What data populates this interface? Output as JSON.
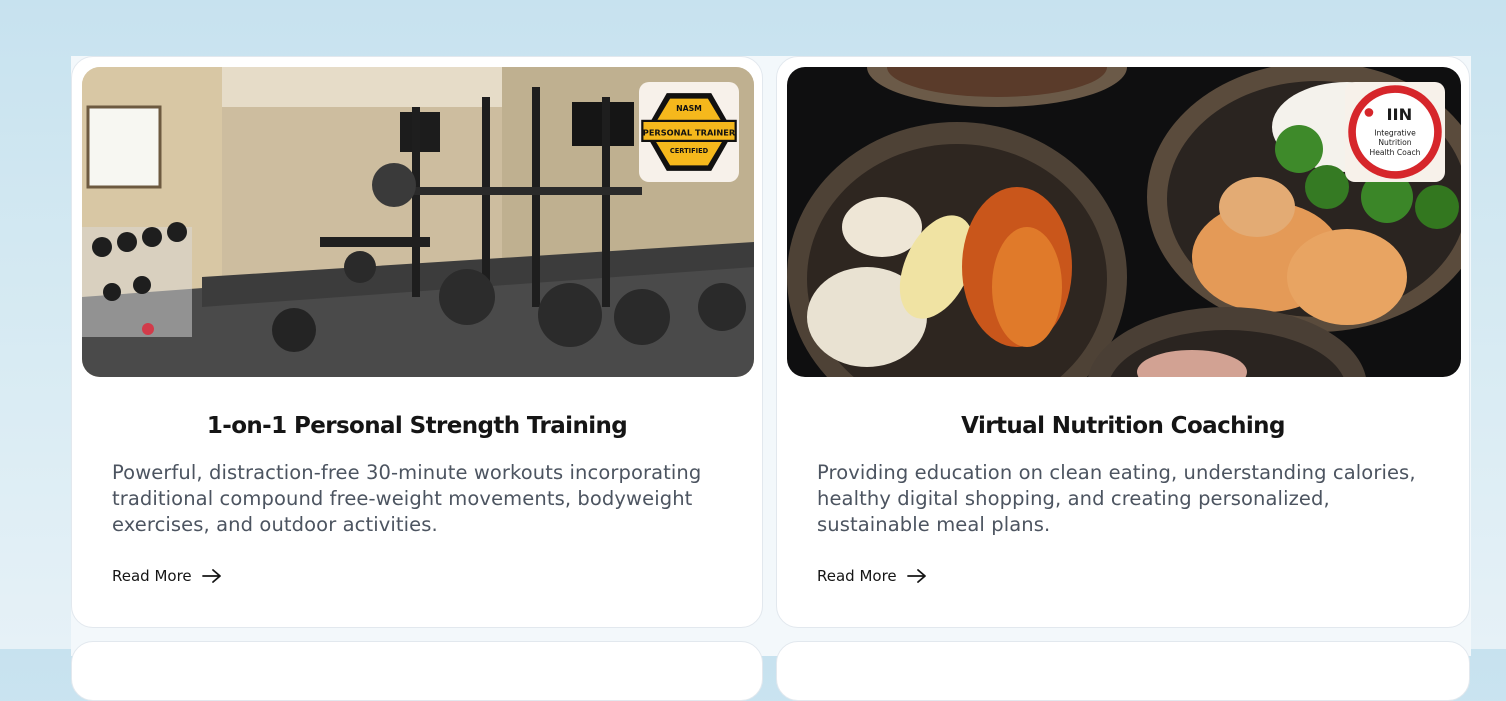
{
  "cards": [
    {
      "title": "1-on-1 Personal Strength Training",
      "description": "Powerful, distraction-free 30-minute workouts incorporating traditional compound free-weight movements, bodyweight exercises, and outdoor activities.",
      "link_label": "Read More",
      "badge": {
        "top_text": "NASM",
        "main_text": "PERSONAL TRAINER",
        "sub_text": "CERTIFIED",
        "color": "#f5b81c"
      }
    },
    {
      "title": "Virtual Nutrition Coaching",
      "description": "Providing education on clean eating, understanding calories, healthy digital shopping, and creating personalized, sustainable meal plans.",
      "link_label": "Read More",
      "badge": {
        "logo_text": "IIN",
        "line1": "Integrative",
        "line2": "Nutrition",
        "line3": "Health Coach",
        "color": "#d6262b"
      }
    }
  ],
  "colors": {
    "card_bg": "#ffffff",
    "page_bg": "#c7e2ef",
    "title": "#151515",
    "body": "#4c5460"
  }
}
